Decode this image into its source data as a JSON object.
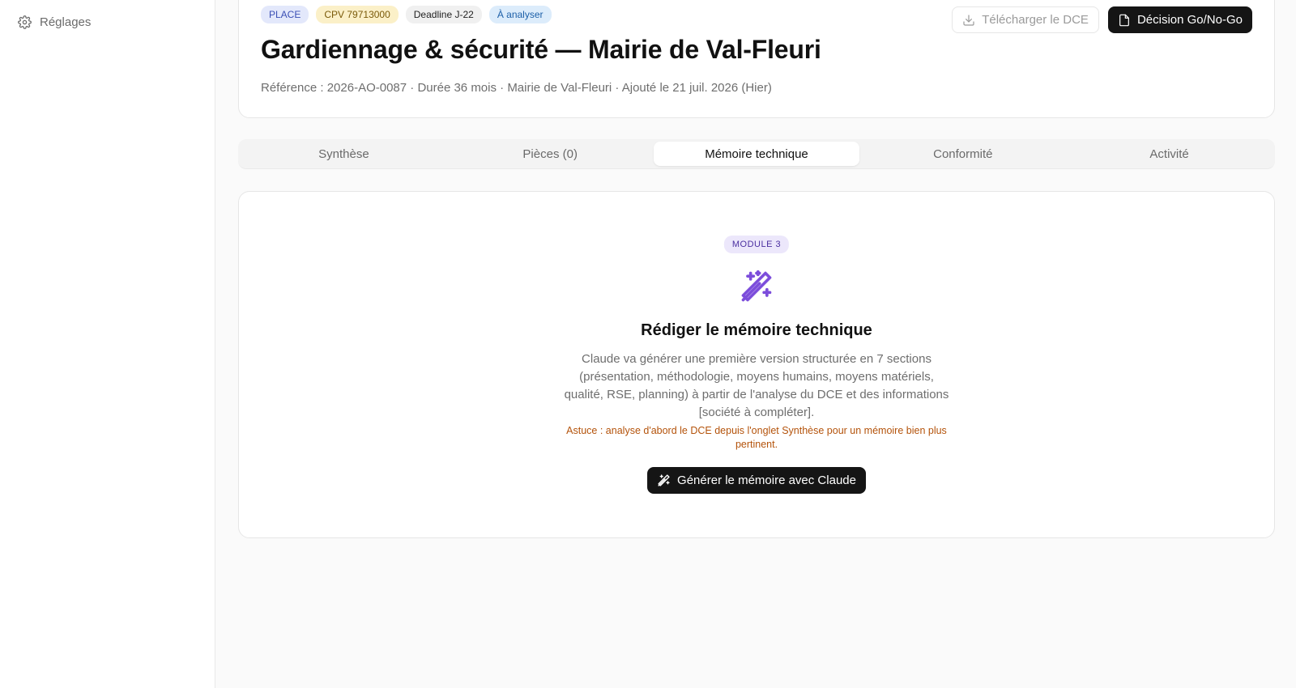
{
  "sidebar": {
    "items": [
      {
        "label": "Réglages",
        "icon": "gear-icon"
      }
    ]
  },
  "header": {
    "badges": {
      "source": "PLACE",
      "cpv": "CPV 79713000",
      "deadline": "Deadline J-22",
      "status": "À analyser"
    },
    "title": "Gardiennage & sécurité — Mairie de Val-Fleuri",
    "meta": "Référence : 2026-AO-0087 · Durée 36 mois · Mairie de Val-Fleuri · Ajouté le 21 juil. 2026 (Hier)",
    "download_label": "Télécharger le DCE",
    "decision_label": "Décision Go/No-Go"
  },
  "tabs": [
    {
      "label": "Synthèse",
      "active": false
    },
    {
      "label": "Pièces (0)",
      "active": false
    },
    {
      "label": "Mémoire technique",
      "active": true
    },
    {
      "label": "Conformité",
      "active": false
    },
    {
      "label": "Activité",
      "active": false
    }
  ],
  "memoire": {
    "module_badge": "MODULE 3",
    "title": "Rédiger le mémoire technique",
    "description": "Claude va générer une première version structurée en 7 sections (présentation, méthodologie, moyens humains, moyens matériels, qualité, RSE, planning) à partir de l'analyse du DCE et des informations [société à compléter].",
    "hint": "Astuce : analyse d'abord le DCE depuis l'onglet Synthèse pour un mémoire bien plus pertinent.",
    "generate_label": "Générer le mémoire avec Claude"
  },
  "colors": {
    "accent_purple": "#7c4ddb",
    "dark_button": "#151515",
    "hint_orange": "#b4530b"
  }
}
